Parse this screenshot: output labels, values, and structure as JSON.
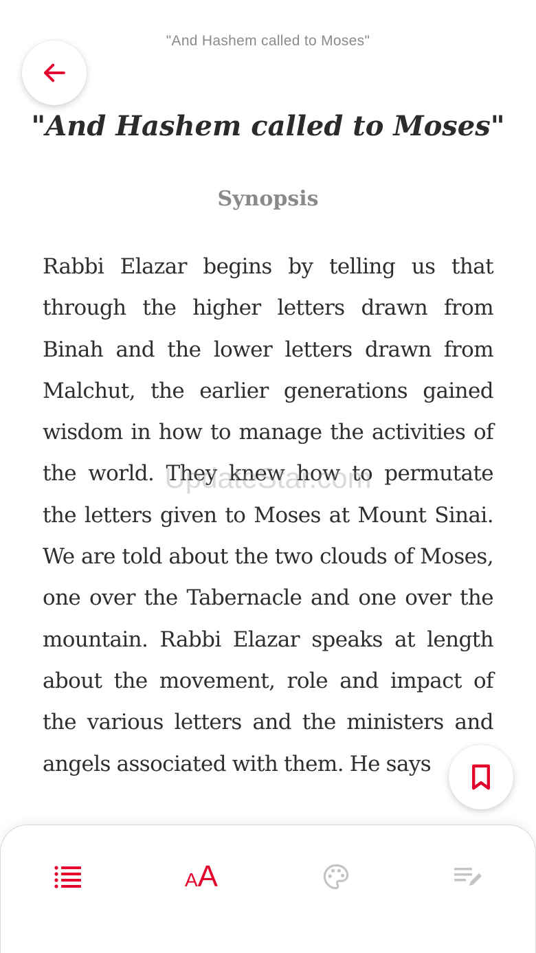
{
  "header": {
    "top_title": "\"And Hashem called to Moses\"",
    "back_icon": "arrow-left-icon"
  },
  "content": {
    "chapter_title": "\"And Hashem called to Moses\"",
    "section_heading": "Synopsis",
    "paragraph": "Rabbi Elazar begins by telling us that through the higher letters drawn from Binah and the lower letters drawn from Malchut, the earlier generations gained wisdom in how to manage the activities of the world. They knew how to permutate the letters given to Moses at Mount Sinai. We are told about the two clouds of Moses, one over the Tabernacle and one over the mountain. Rabbi Elazar speaks at length about the movement, role and impact of the various letters and the ministers and angels associated with them. He says"
  },
  "watermark": "UpdateStar.com",
  "bookmark": {
    "icon": "bookmark-icon"
  },
  "toolbar": {
    "items": [
      {
        "icon": "list-icon",
        "active": true
      },
      {
        "icon": "font-size-icon",
        "label_small": "A",
        "label_big": "A",
        "active": true
      },
      {
        "icon": "palette-icon",
        "active": false
      },
      {
        "icon": "notes-icon",
        "active": false
      }
    ]
  },
  "colors": {
    "accent": "#e3002b",
    "inactive_icon": "#c4c4c4",
    "body_text": "#2e2e2e",
    "muted_text": "#8a8a8a"
  }
}
